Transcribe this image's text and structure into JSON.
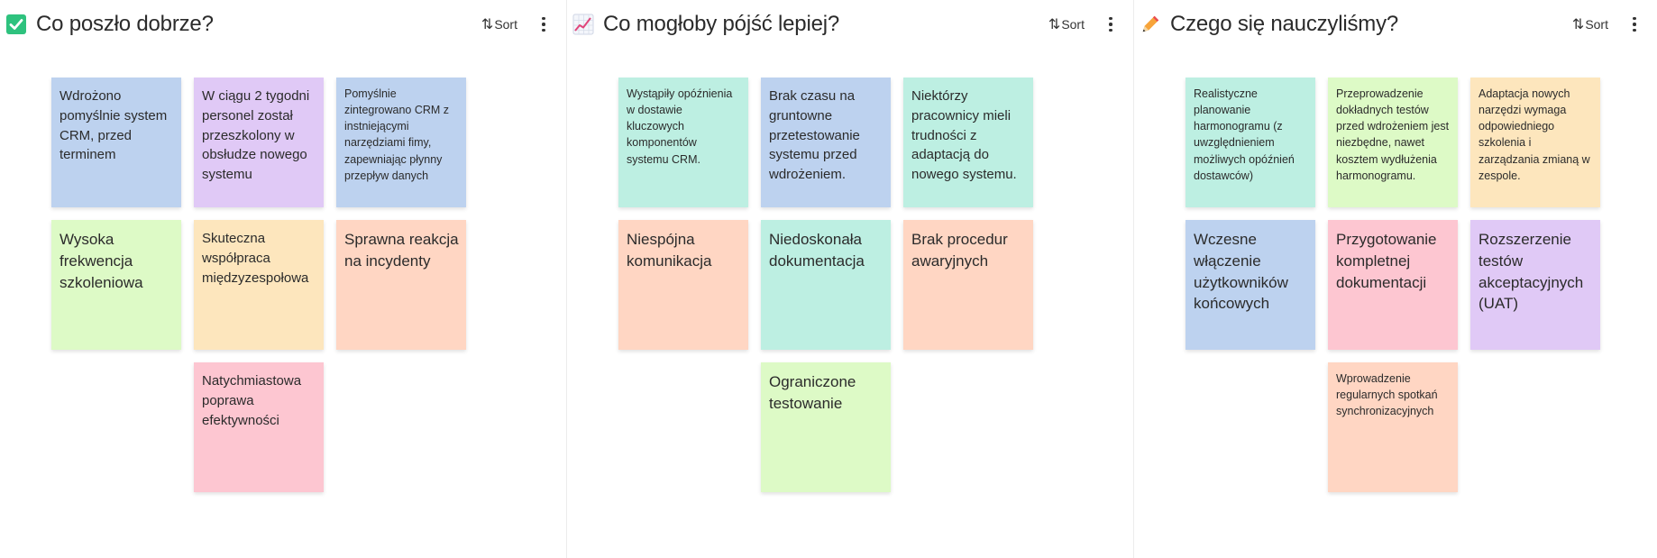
{
  "sort_label": "Sort",
  "columns": [
    {
      "title": "Co poszło dobrze?",
      "emoji": "check-mark-button-icon",
      "notes": [
        {
          "text": "Wdrożono pomyślnie system CRM, przed terminem",
          "color": "#bdd2ef"
        },
        {
          "text": "W ciągu 2 tygodni personel został przeszkolony w obsłudze nowego systemu",
          "color": "#e0c9f6"
        },
        {
          "text": "Pomyślnie zintegrowano CRM z instniejącymi narzędziami fimy, zapewniając płynny przepływ danych",
          "color": "#bdd2ef"
        },
        {
          "text": "Wysoka frekwencja szkoleniowa",
          "color": "#ddfac6"
        },
        {
          "text": "Skuteczna współpraca międzyzespołowa",
          "color": "#fde6bd"
        },
        {
          "text": "Sprawna reakcja na incydenty",
          "color": "#ffd6c3"
        },
        {
          "text": "Natychmiastowa poprawa efektywności",
          "color": "#fdc6d1"
        }
      ]
    },
    {
      "title": "Co mogłoby pójść lepiej?",
      "emoji": "chart-increasing-icon",
      "notes": [
        {
          "text": "Wystąpiły opóźnienia w dostawie kluczowych komponentów systemu CRM.",
          "color": "#bdefe2"
        },
        {
          "text": "Brak czasu na gruntowne przetestowanie systemu przed wdrożeniem.",
          "color": "#bdd2ef"
        },
        {
          "text": "Niektórzy pracownicy mieli trudności z adaptacją do nowego systemu.",
          "color": "#bdefe2"
        },
        {
          "text": "Niespójna komunikacja",
          "color": "#ffd6c3"
        },
        {
          "text": "Niedoskonała dokumentacja",
          "color": "#bdefe2"
        },
        {
          "text": "Brak procedur awaryjnych",
          "color": "#ffd6c3"
        },
        {
          "text": "Ograniczone testowanie",
          "color": "#ddfac6"
        }
      ]
    },
    {
      "title": "Czego się nauczyliśmy?",
      "emoji": "pencil-icon",
      "notes": [
        {
          "text": "Realistyczne planowanie harmonogramu (z uwzględnieniem możliwych opóźnień dostawców)",
          "color": "#bdefe2"
        },
        {
          "text": "Przeprowadzenie dokładnych testów przed wdrożeniem jest niezbędne, nawet kosztem wydłużenia harmonogramu.",
          "color": "#ddfac6"
        },
        {
          "text": "Adaptacja nowych narzędzi wymaga odpowiedniego szkolenia i zarządzania zmianą w zespole.",
          "color": "#fde6bd"
        },
        {
          "text": "Wczesne włączenie użytkowników końcowych",
          "color": "#bdd2ef"
        },
        {
          "text": "Przygotowanie kompletnej dokumentacji",
          "color": "#fdc6d1"
        },
        {
          "text": "Rozszerzenie testów akceptacyjnych (UAT)",
          "color": "#e0c9f6"
        },
        {
          "text": "Wprowadzenie regularnych spotkań synchronizacyjnych",
          "color": "#ffd6c3"
        }
      ]
    }
  ]
}
